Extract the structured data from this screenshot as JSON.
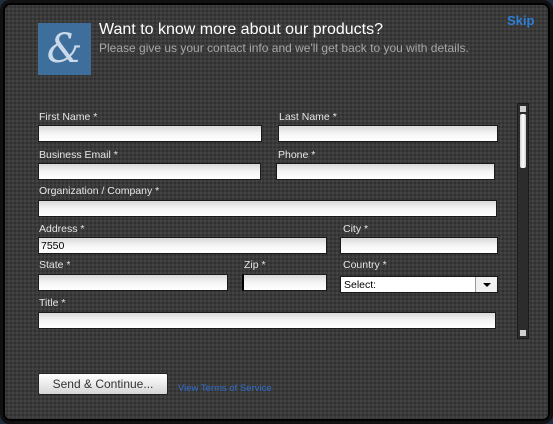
{
  "header": {
    "skip_label": "Skip",
    "title": "Want to know more about our products?",
    "subtitle": "Please give us your contact info and we'll get back to you with details."
  },
  "form": {
    "first_name": {
      "label": "First Name *",
      "value": ""
    },
    "last_name": {
      "label": "Last Name *",
      "value": ""
    },
    "business_email": {
      "label": "Business Email *",
      "value": ""
    },
    "phone": {
      "label": "Phone *",
      "value": ""
    },
    "organization": {
      "label": "Organization / Company *",
      "value": ""
    },
    "address": {
      "label": "Address *",
      "value": "7550"
    },
    "city": {
      "label": "City *",
      "value": ""
    },
    "state": {
      "label": "State *",
      "value": ""
    },
    "zip": {
      "label": "Zip *",
      "value": ""
    },
    "country": {
      "label": "Country *",
      "selected": "Select:"
    },
    "title": {
      "label": "Title *",
      "value": ""
    }
  },
  "actions": {
    "send_label": "Send & Continue...",
    "tos_label": "View Terms of Service"
  },
  "colors": {
    "accent_link": "#2f7fd6",
    "logo_bg": "#3e6e9c"
  },
  "icons": {
    "logo": "ampersand-logo-icon",
    "select_arrow": "chevron-down-icon"
  }
}
